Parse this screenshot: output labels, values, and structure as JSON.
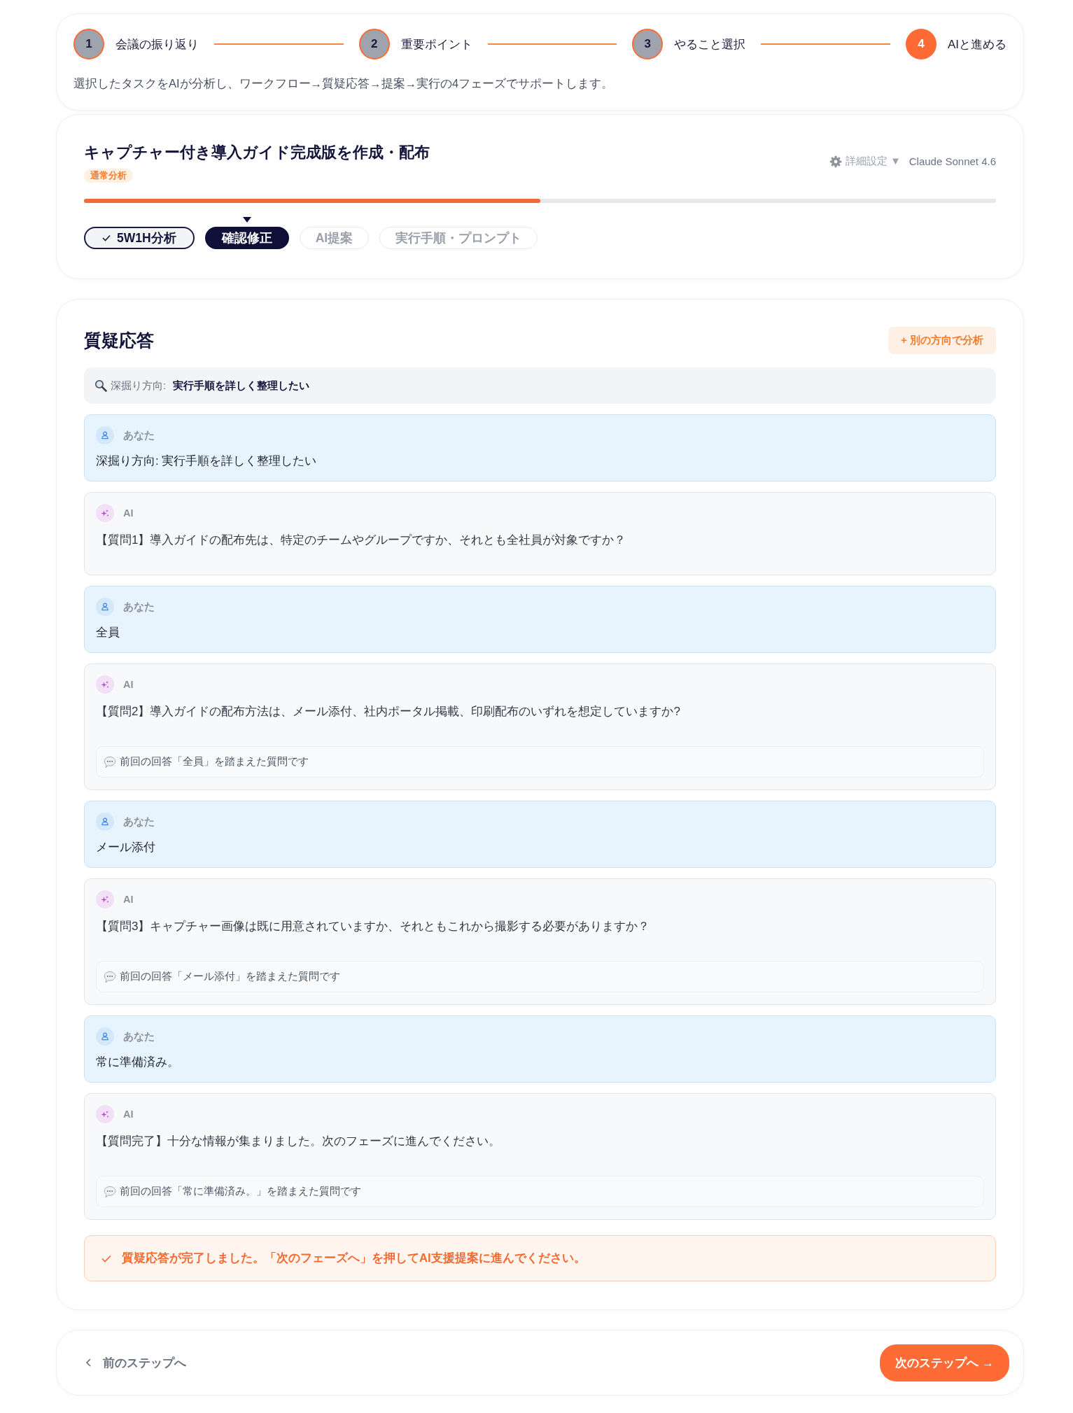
{
  "stepper": {
    "steps": [
      {
        "number": "1",
        "label": "会議の振り返り",
        "selected": false
      },
      {
        "number": "2",
        "label": "重要ポイント",
        "selected": false
      },
      {
        "number": "3",
        "label": "やること選択",
        "selected": false
      },
      {
        "number": "4",
        "label": "AIと進める",
        "selected": true
      }
    ],
    "description": "選択したタスクをAIが分析し、ワークフロー→質疑応答→提案→実行の4フェーズでサポートします。"
  },
  "task": {
    "title": "キャプチャー付き導入ガイド完成版を作成・配布",
    "badge": "通常分析",
    "settings_label": "詳細設定 ▼",
    "model": "Claude Sonnet 4.6",
    "progress": {
      "level": 0.5
    },
    "phases": [
      {
        "label": "5W1H分析",
        "done": true,
        "selected": false
      },
      {
        "label": "確認修正",
        "done": false,
        "selected": true
      },
      {
        "label": "AI提案",
        "done": false,
        "selected": false
      },
      {
        "label": "実行手順・プロンプト",
        "done": false,
        "selected": false
      }
    ]
  },
  "qa": {
    "title": "質疑応答",
    "add_button": "+ 別の方向で分析",
    "direction": {
      "label": "深掘り方向:",
      "value": "実行手順を詳しく整理したい"
    },
    "messages": [
      {
        "kind": "user",
        "sender": "あなた",
        "text": "深掘り方向: 実行手順を詳しく整理したい"
      },
      {
        "kind": "ai",
        "sender": "AI",
        "text": "【質問1】導入ガイドの配布先は、特定のチームやグループですか、それとも全社員が対象ですか？"
      },
      {
        "kind": "user",
        "sender": "あなた",
        "text": "全員"
      },
      {
        "kind": "ai",
        "sender": "AI",
        "text": "【質問2】導入ガイドの配布方法は、メール添付、社内ポータル掲載、印刷配布のいずれを想定していますか?",
        "note": "前回の回答「全員」を踏まえた質問です"
      },
      {
        "kind": "user",
        "sender": "あなた",
        "text": "メール添付"
      },
      {
        "kind": "ai",
        "sender": "AI",
        "text": "【質問3】キャプチャー画像は既に用意されていますか、それともこれから撮影する必要がありますか？",
        "note": "前回の回答「メール添付」を踏まえた質問です"
      },
      {
        "kind": "user",
        "sender": "あなた",
        "text": "常に準備済み。"
      },
      {
        "kind": "ai",
        "sender": "AI",
        "text": "【質問完了】十分な情報が集まりました。次のフェーズに進んでください。",
        "note": "前回の回答「常に準備済み。」を踏まえた質問です"
      }
    ],
    "completion": "質疑応答が完了しました。「次のフェーズへ」を押してAI支援提案に進んでください。"
  },
  "footer": {
    "back": "前のステップへ",
    "next": "次のステップへ →"
  }
}
